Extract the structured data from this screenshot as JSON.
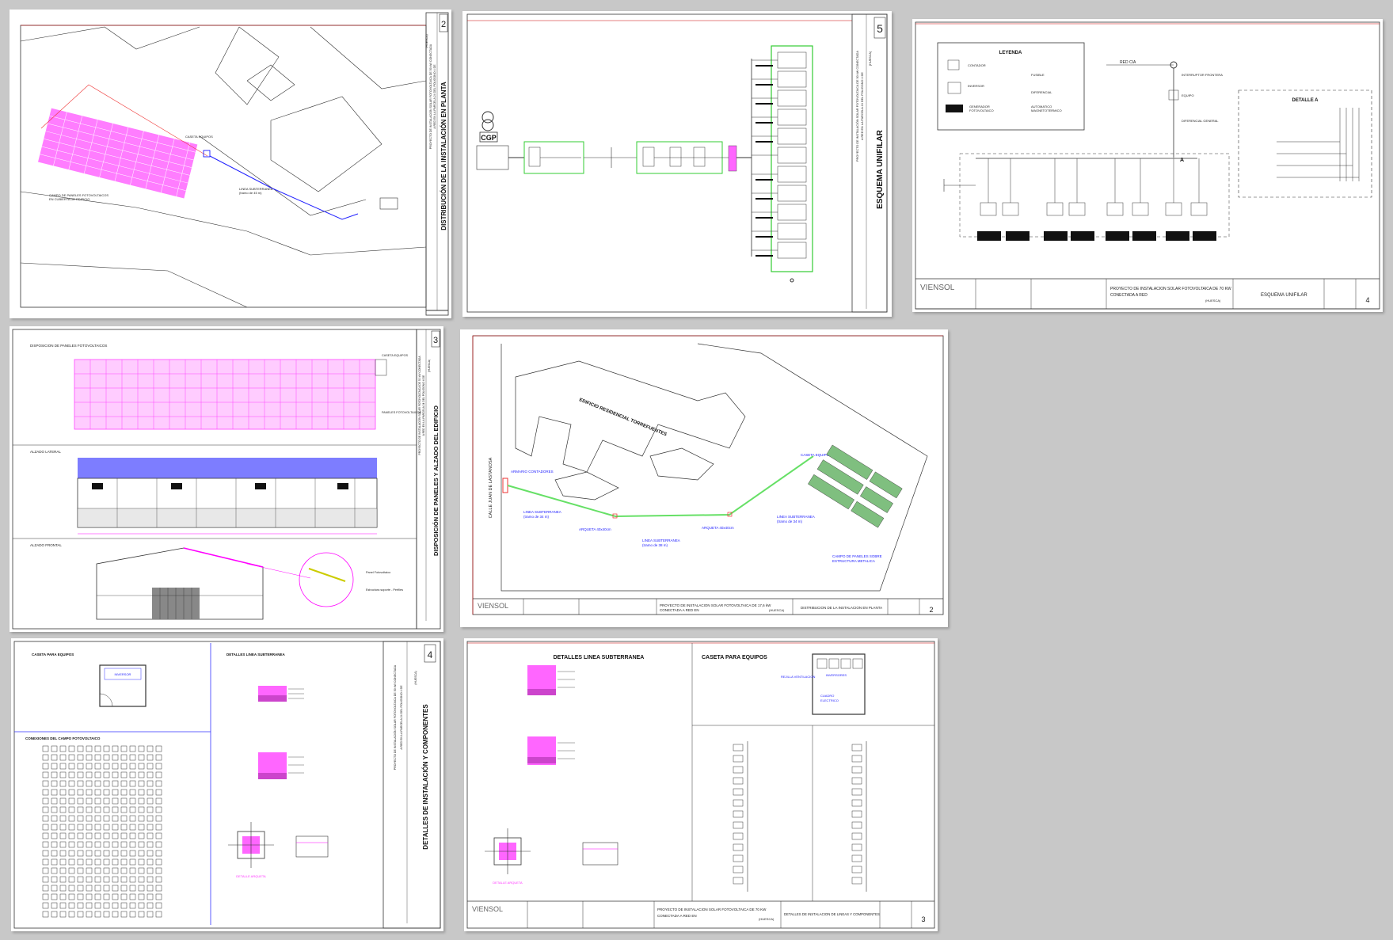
{
  "sheets": {
    "s2": {
      "number": "2",
      "title": "DISTRIBUCIÓN DE LA INSTALACIÓN EN PLANTA",
      "project": "PROYECTO DE INSTALACIÓN SOLAR FOTOVOLTAICA DE 50 kW CONECTADA",
      "project2": "A RED EN LA PARCELA 24 DEL POLIGONO 4 DE",
      "project3": "(HUESCA)",
      "caseta": "CASETA EQUIPOS",
      "campo": "CAMPO DE PANELES FOTOVOLTAICOS",
      "campo2": "EN CUBIERTA DE EDIFICIO",
      "linea": "LINEA SUBTERRANEA",
      "tramo": "(tramo de 45 m)"
    },
    "s5": {
      "number": "5",
      "title": "ESQUEMA UNIFILAR",
      "cgp": "CGP",
      "project": "PROYECTO DE INSTALACIÓN SOLAR FOTOVOLTAICA DE 50 kW CONECTADA",
      "project2": "A RED EN LA PARCELA 24 DEL POLIGONO 4 DE",
      "project3": "(HUESCA)"
    },
    "s4b": {
      "legend_title": "LEYENDA",
      "contador": "CONTADOR",
      "fusible": "FUSIBLE",
      "diferencial": "DIFERENCIAL",
      "automatico": "AUTOMATICO",
      "magneto": "MAGNETOTERMICO",
      "inversor": "INVERSOR",
      "generador": "GENERADOR",
      "fotovoltaico": "FOTOVOLTAICO",
      "red": "RED CIA",
      "interruptor": "INTERRUPTOR FRONTERA",
      "equipo": "EQUIPO",
      "int_general": "DIFERENCIAL GENERAL",
      "detalle": "DETALLE A",
      "a": "A",
      "company": "VIENSOL",
      "project": "PROYECTO DE INSTALACION SOLAR FOTOVOLTAICA DE 70 KW",
      "project2": "CONECTADA A RED",
      "region": "(HUESCA)",
      "sheet_title": "ESQUEMA UNIFILAR",
      "number": "4"
    },
    "s3": {
      "number": "3",
      "title": "DISPOSICIÓN DE PANELES Y ALZADO DEL EDIFICIO",
      "disposicion": "DISPOSICION DE PANELES FOTOVOLTAICOS",
      "alzado_lateral": "ALZADO LATERAL",
      "alzado_frontal": "ALZADO FRONTAL",
      "caseta": "CASETA EQUIPOS",
      "paneles": "PANELES FOTOVOLTAICOS",
      "project": "PROYECTO DE INSTALACIÓN SOLAR FOTOVOLTAICA DE 50 kW CONECTADA",
      "project2": "A RED EN LA PARCELA 24 DEL POLIGONO 4 DE",
      "project3": "(HUESCA)",
      "panel_fv": "Panel Fotovoltaico",
      "estructura": "Estructura soporte - Perfiles"
    },
    "s7": {
      "calle": "CALLE JUAN DE LASTANOSA",
      "edificio": "EDIFICIO RESIDENCIAL TORREFUENTES",
      "armario": "ARMARIO CONTADORES",
      "caseta": "CASETA EQUIPOS",
      "linea1": "LINEA SUBTERRANEA",
      "tramo1": "(tramo de 34 m)",
      "arqueta1": "ARQUETA 40x40cm",
      "linea2": "LINEA SUBTERRANEA",
      "tramo2": "(tramo de 38 m)",
      "arqueta2": "ARQUETA 40x40cm",
      "linea3": "LINEA SUBTERRANEA",
      "tramo3": "(tramo de 34 m)",
      "campo": "CAMPO DE PANELES SOBRE",
      "campo2": "ESTRUCTURA METALICA",
      "company": "VIENSOL",
      "project": "PROYECTO DE INSTALACION SOLAR FOTOVOLTAICA DE 17,6 kW",
      "project2": "CONECTADA A RED EN",
      "region": "(HUESCA)",
      "sheet_title": "DISTRIBUCION DE LA INSTALACION EN PLANTA",
      "number": "2"
    },
    "s4": {
      "number": "4",
      "title": "DETALLES DE INSTALACIÓN Y COMPONENTES",
      "caseta": "CASETA PARA EQUIPOS",
      "detalles": "DETALLES LINEA SUBTERRANEA",
      "conexiones": "CONEXIONES DEL CAMPO FOTOVOLTAICO",
      "inversor": "INVERSOR",
      "project": "PROYECTO DE INSTALACIÓN SOLAR FOTOVOLTAICA DE 50 kW CONECTADA",
      "project2": "A RED EN LA PARCELA 24 DEL POLIGONO 4 DE",
      "project3": "(HUESCA)",
      "arqueta": "DETALLE ARQUETA"
    },
    "s3b": {
      "detalles": "DETALLES LINEA SUBTERRANEA",
      "caseta": "CASETA PARA EQUIPOS",
      "rejilla": "REJILLA VENTILACION",
      "inversores": "INVERSORES",
      "cuadro": "CUADRO",
      "electrico": "ELECTRICO",
      "company": "VIENSOL",
      "project": "PROYECTO DE INSTALACION SOLAR FOTOVOLTAICA DE 70 KW",
      "project2": "CONECTADA A RED EN",
      "region": "(HUESCA)",
      "sheet_title": "DETALLES DE INSTALACION DE LINEAS Y COMPONENTES",
      "number": "3",
      "arqueta": "DETALLE ARQUETA"
    }
  }
}
